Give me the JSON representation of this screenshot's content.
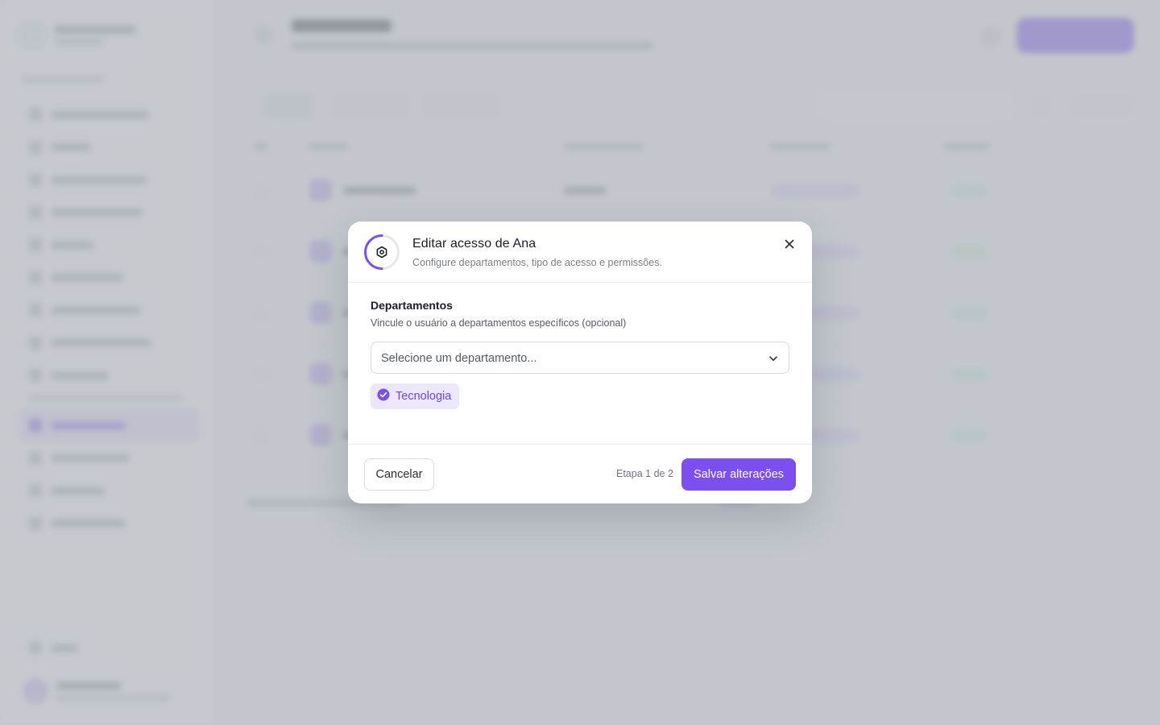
{
  "modal": {
    "title": "Editar acesso de Ana",
    "subtitle": "Configure departamentos, tipo de acesso e permissões.",
    "progress": {
      "step": 1,
      "total": 2,
      "fraction": 0.5
    },
    "header_icon": "hexagon-settings-icon",
    "close_icon": "close-icon"
  },
  "departments": {
    "label": "Departamentos",
    "help": "Vincule o usuário a departamentos específicos (opcional)",
    "select": {
      "placeholder": "Selecione um departamento...",
      "icon": "chevron-down-icon"
    },
    "selected": [
      {
        "label": "Tecnologia",
        "icon": "check-circle-icon"
      }
    ]
  },
  "footer": {
    "cancel_label": "Cancelar",
    "step_text": "Etapa 1 de 2",
    "save_label": "Salvar alterações"
  },
  "colors": {
    "accent": "#7c4ff0",
    "tag_bg": "#ede7fd",
    "overlay": "#b0b6bc"
  }
}
